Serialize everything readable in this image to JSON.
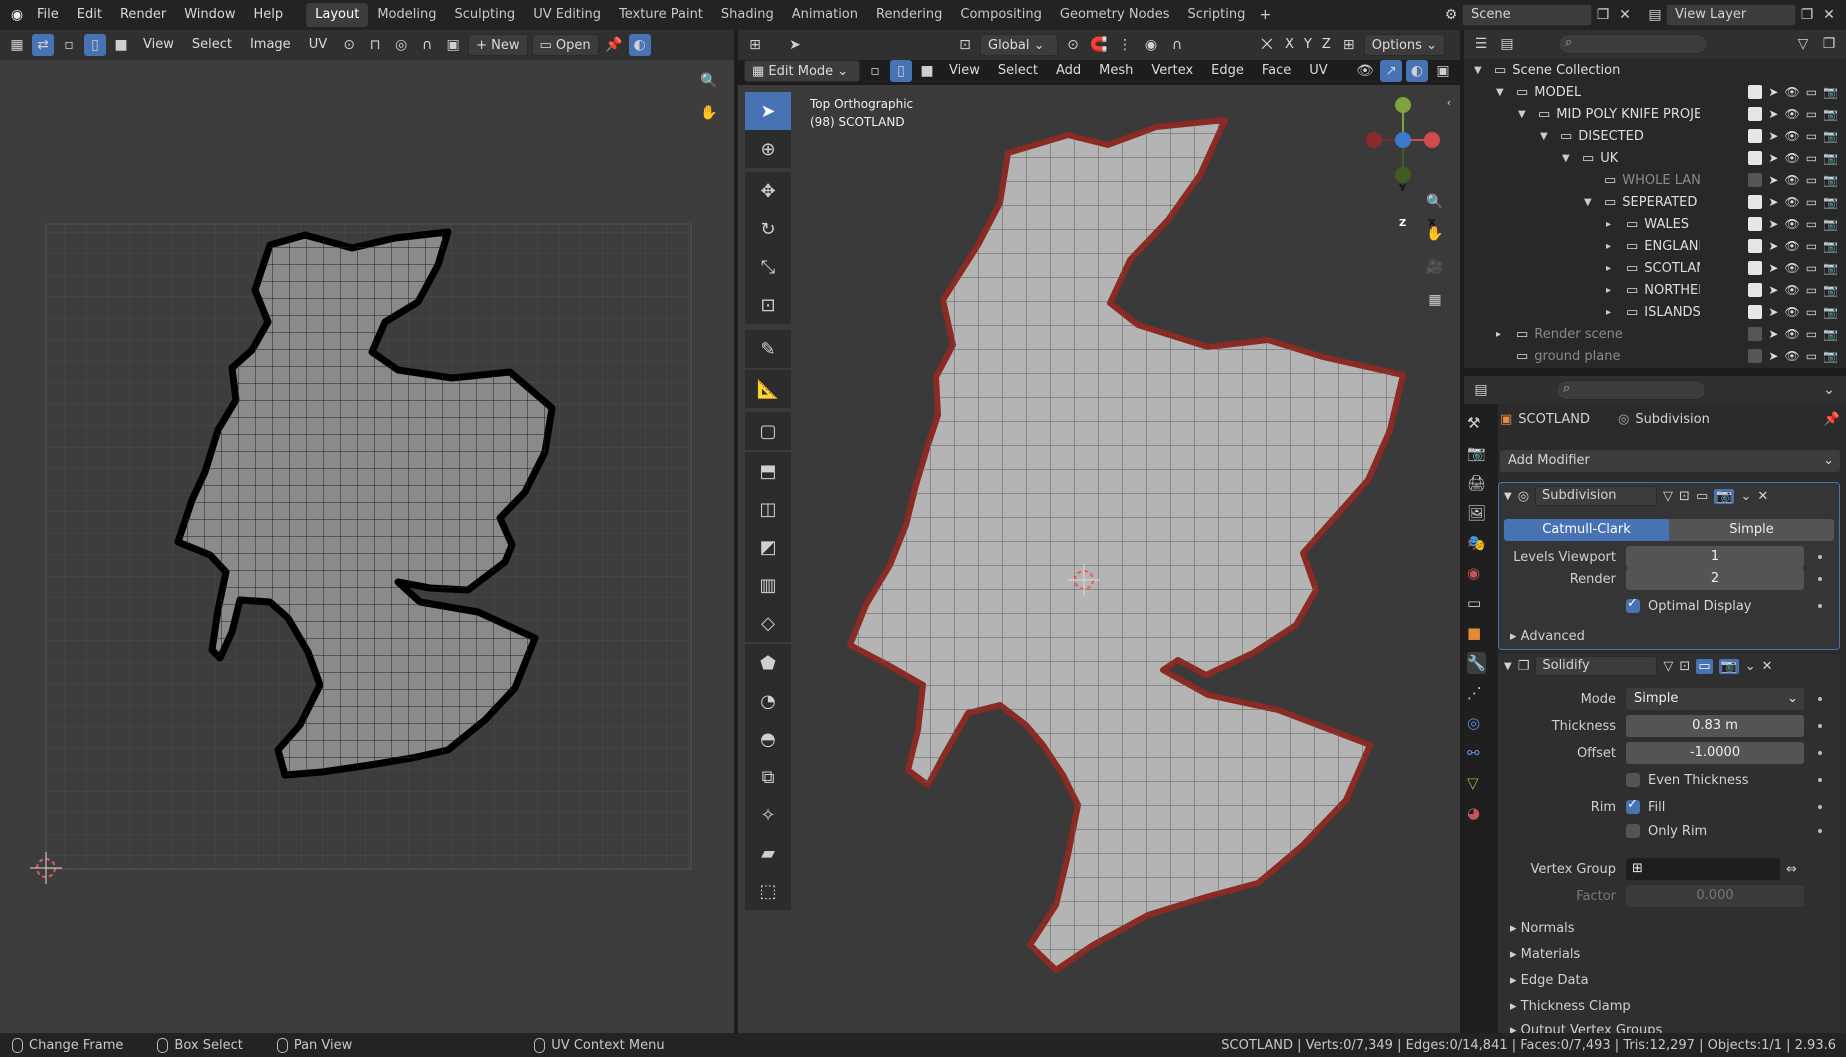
{
  "menu": [
    "File",
    "Edit",
    "Render",
    "Window",
    "Help"
  ],
  "workspaces": [
    "Layout",
    "Modeling",
    "Sculpting",
    "UV Editing",
    "Texture Paint",
    "Shading",
    "Animation",
    "Rendering",
    "Compositing",
    "Geometry Nodes",
    "Scripting"
  ],
  "active_workspace": "Layout",
  "scene_name": "Scene",
  "view_layer": "View Layer",
  "uv_editor": {
    "menus": [
      "View",
      "Select",
      "Image",
      "UV"
    ],
    "new_label": "New",
    "open_label": "Open"
  },
  "viewport": {
    "mode": "Edit Mode",
    "menus": [
      "View",
      "Select",
      "Add",
      "Mesh",
      "Vertex",
      "Edge",
      "Face",
      "UV"
    ],
    "transform_orientation": "Global",
    "axes": [
      "X",
      "Y",
      "Z"
    ],
    "options_label": "Options",
    "view_name": "Top Orthographic",
    "object_info": "(98) SCOTLAND",
    "gizmo_labels": {
      "x": "X",
      "y": "Y",
      "z": "Z"
    }
  },
  "outliner": {
    "items": [
      {
        "name": "Scene Collection",
        "depth": 0,
        "dim": false
      },
      {
        "name": "MODEL",
        "depth": 1,
        "dim": false
      },
      {
        "name": "MID POLY KNIFE PROJECT",
        "depth": 2,
        "dim": false
      },
      {
        "name": "DISECTED",
        "depth": 3,
        "dim": false
      },
      {
        "name": "UK",
        "depth": 4,
        "dim": false
      },
      {
        "name": "WHOLE LAND",
        "depth": 5,
        "dim": true
      },
      {
        "name": "SEPERATED PIECES",
        "depth": 5,
        "dim": false
      },
      {
        "name": "WALES",
        "depth": 6,
        "dim": false
      },
      {
        "name": "ENGLAND",
        "depth": 6,
        "dim": false
      },
      {
        "name": "SCOTLAND",
        "depth": 6,
        "dim": false
      },
      {
        "name": "NORTHERN IRE",
        "depth": 6,
        "dim": false
      },
      {
        "name": "ISLANDS",
        "depth": 6,
        "dim": false
      },
      {
        "name": "Render scene",
        "depth": 1,
        "dim": true
      },
      {
        "name": "ground plane",
        "depth": 1,
        "dim": true
      }
    ]
  },
  "properties": {
    "object_name": "SCOTLAND",
    "modifier_tab": "Subdivision",
    "add_modifier": "Add Modifier",
    "subdivision": {
      "name": "Subdivision",
      "type_a": "Catmull-Clark",
      "type_b": "Simple",
      "levels_viewport_label": "Levels Viewport",
      "levels_viewport": "1",
      "render_label": "Render",
      "render": "2",
      "optimal_display": "Optimal Display",
      "advanced": "Advanced"
    },
    "solidify": {
      "name": "Solidify",
      "mode_label": "Mode",
      "mode": "Simple",
      "thickness_label": "Thickness",
      "thickness": "0.83 m",
      "offset_label": "Offset",
      "offset": "-1.0000",
      "even_thickness": "Even Thickness",
      "rim_label": "Rim",
      "fill": "Fill",
      "only_rim": "Only Rim",
      "vertex_group_label": "Vertex Group",
      "factor_label": "Factor",
      "factor": "0.000",
      "sections": [
        "Normals",
        "Materials",
        "Edge Data",
        "Thickness Clamp",
        "Output Vertex Groups"
      ]
    }
  },
  "status": {
    "left": [
      {
        "label": "Change Frame"
      },
      {
        "label": "Box Select"
      },
      {
        "label": "Pan View"
      },
      {
        "label": "UV Context Menu"
      }
    ],
    "stats": "SCOTLAND | Verts:0/7,349 | Edges:0/14,841 | Faces:0/7,493 | Tris:12,297 | Objects:1/1 | 2.93.6"
  }
}
